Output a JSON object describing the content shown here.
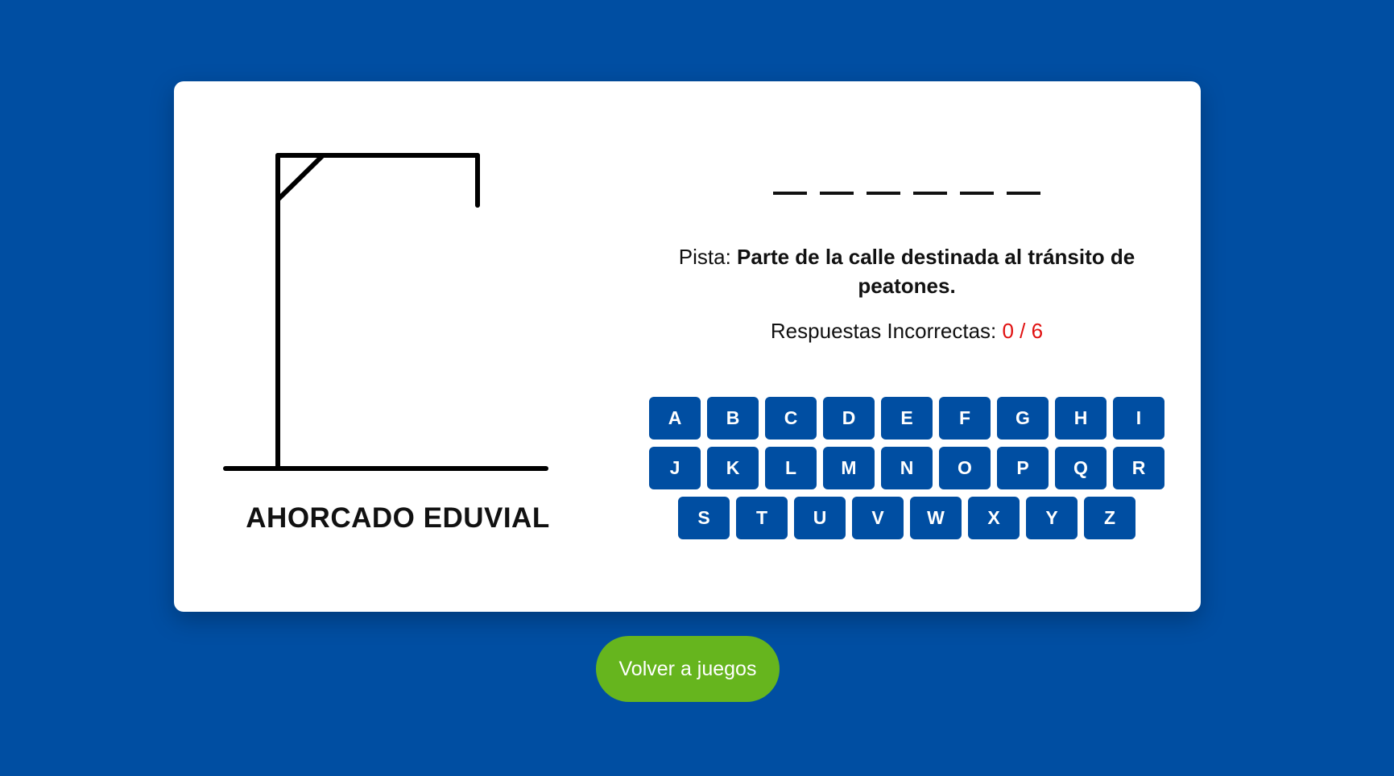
{
  "game": {
    "title": "AHORCADO EDUVIAL",
    "blank_count": 6,
    "hint_label": "Pista:",
    "hint_text": "Parte de la calle destinada al tránsito de peatones.",
    "wrong_label": "Respuestas Incorrectas:",
    "wrong_count": "0 / 6"
  },
  "keyboard": {
    "rows": [
      [
        "A",
        "B",
        "C",
        "D",
        "E",
        "F",
        "G",
        "H",
        "I"
      ],
      [
        "J",
        "K",
        "L",
        "M",
        "N",
        "O",
        "P",
        "Q",
        "R"
      ],
      [
        "S",
        "T",
        "U",
        "V",
        "W",
        "X",
        "Y",
        "Z"
      ]
    ]
  },
  "back_button": {
    "label": "Volver a juegos"
  },
  "colors": {
    "background": "#004ea2",
    "key": "#004ea2",
    "back_button": "#66b51e",
    "wrong_count": "#e01010"
  }
}
